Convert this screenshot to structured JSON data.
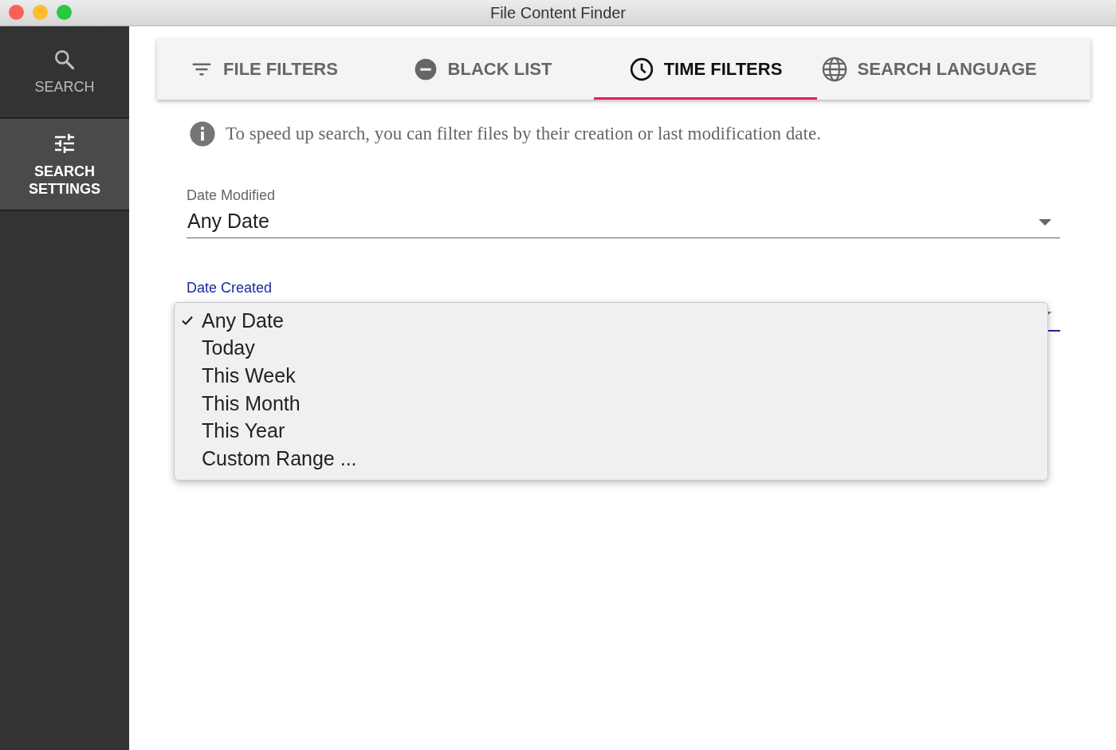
{
  "window": {
    "title": "File Content Finder"
  },
  "sidebar": {
    "items": [
      {
        "label": "SEARCH",
        "selected": false
      },
      {
        "label": "SEARCH SETTINGS",
        "selected": true
      }
    ]
  },
  "tabs": [
    {
      "label": "FILE FILTERS",
      "selected": false
    },
    {
      "label": "BLACK LIST",
      "selected": false
    },
    {
      "label": "TIME FILTERS",
      "selected": true
    },
    {
      "label": "SEARCH LANGUAGE",
      "selected": false
    }
  ],
  "info": "To speed up search, you can filter files by their creation or last modification date.",
  "fields": [
    {
      "label": "Date Modified",
      "value": "Any Date",
      "focused": false
    },
    {
      "label": "Date Created",
      "focused": true,
      "menu": [
        {
          "label": "Any Date",
          "selected": true
        },
        {
          "label": "Today",
          "selected": false
        },
        {
          "label": "This Week",
          "selected": false
        },
        {
          "label": "This Month",
          "selected": false
        },
        {
          "label": "This Year",
          "selected": false
        },
        {
          "label": "Custom Range ...",
          "selected": false
        }
      ]
    }
  ]
}
